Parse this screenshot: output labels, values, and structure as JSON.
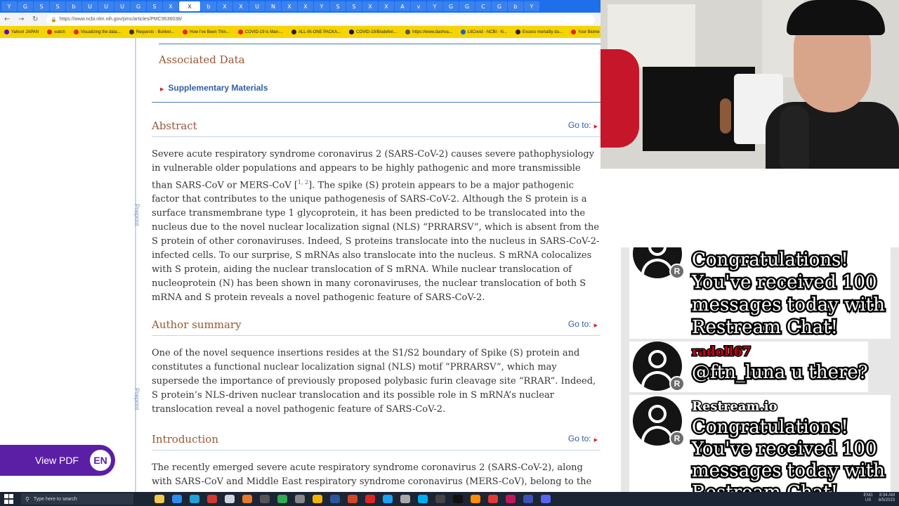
{
  "browser": {
    "tabs": [
      "Y",
      "G",
      "S",
      "S",
      "b",
      "U",
      "U",
      "U",
      "G",
      "S",
      "X",
      "X",
      "b",
      "X",
      "X",
      "U",
      "N",
      "X",
      "X",
      "Y",
      "S",
      "S",
      "X",
      "X",
      "A",
      "v",
      "Y",
      "G",
      "G",
      "C",
      "G",
      "b",
      "Y"
    ],
    "url": "https://www.ncbi.nlm.nih.gov/pmc/articles/PMC9536038/",
    "bookmarks": [
      "Yahoo! JAPAN",
      "watch",
      "Visualizing the data...",
      "Requests · Bunker...",
      "How I've Been Thin...",
      "COVID-19 is Man-...",
      "ALL-IN-ONE PACKA...",
      "COVID-19/Biodefen...",
      "https://www.dashva...",
      "LitCovid - NCBI - N...",
      "Excess mortality du...",
      "Your Biome"
    ]
  },
  "article": {
    "preprint_label": "Preprint",
    "associated_data": {
      "title": "Associated Data",
      "supplementary": "Supplementary Materials"
    },
    "goto_label": "Go to:",
    "abstract": {
      "title": "Abstract",
      "text_before_ref": "Severe acute respiratory syndrome coronavirus 2 (SARS-CoV-2) causes severe pathophysiology in vulnerable older populations and appears to be highly pathogenic and more transmissible than SARS-CoV or MERS-CoV [",
      "ref": "1, 2",
      "text_after_ref": "]. The spike (S) protein appears to be a major pathogenic factor that contributes to the unique pathogenesis of SARS-CoV-2. Although the S protein is a surface transmembrane type 1 glycoprotein, it has been predicted to be translocated into the nucleus due to the novel nuclear localization signal (NLS) “PRRARSV”, which is absent from the S protein of other coronaviruses. Indeed, S proteins translocate into the nucleus in SARS-CoV-2-infected cells. To our surprise, S mRNAs also translocate into the nucleus. S mRNA colocalizes with S protein, aiding the nuclear translocation of S mRNA. While nuclear translocation of nucleoprotein (N) has been shown in many coronaviruses, the nuclear translocation of both S mRNA and S protein reveals a novel pathogenic feature of SARS-CoV-2."
    },
    "author_summary": {
      "title": "Author summary",
      "text": "One of the novel sequence insertions resides at the S1/S2 boundary of Spike (S) protein and constitutes a functional nuclear localization signal (NLS) motif “PRRARSV”, which may supersede the importance of previously proposed polybasic furin cleavage site “RRAR”. Indeed, S protein’s NLS-driven nuclear translocation and its possible role in S mRNA’s nuclear translocation reveal a novel pathogenic feature of SARS-CoV-2."
    },
    "introduction": {
      "title": "Introduction",
      "text": "The recently emerged severe acute respiratory syndrome coronavirus 2 (SARS-CoV-2), along with SARS-CoV and Middle East respiratory syndrome coronavirus (MERS-CoV), belong to the"
    }
  },
  "view_pdf": {
    "label": "View PDF",
    "badge": "EN"
  },
  "chat": {
    "badge": "R",
    "messages": [
      {
        "name": "",
        "lines": [
          "Congratulations!",
          "You've received 100",
          "messages today with",
          "Restream Chat!"
        ]
      },
      {
        "name": "radoll67",
        "lines": [
          "@ftn_luna u there?"
        ]
      },
      {
        "name": "Restream.io",
        "lines": [
          "Congratulations!",
          "You've received 100",
          "messages today with",
          "Restream Chat!"
        ]
      }
    ]
  },
  "taskbar": {
    "search_placeholder": "Type here to search",
    "lang_top": "ENG",
    "lang_bottom": "US",
    "time": "8:34 AM",
    "date": "8/5/2023"
  }
}
